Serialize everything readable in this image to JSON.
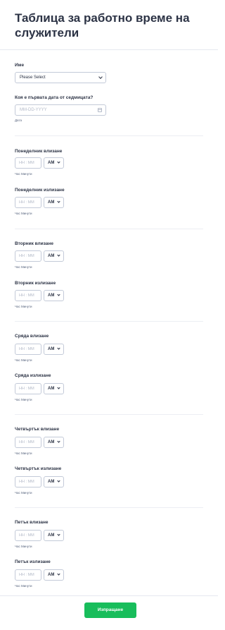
{
  "form": {
    "title": "Таблица за работно време на служители"
  },
  "name_field": {
    "label": "Име",
    "value": "Please Select"
  },
  "first_date_field": {
    "label": "Коя е първата дата от седмицата?",
    "placeholder": "MM-DD-YYYY",
    "sublabel": "Дата"
  },
  "time_fields": [
    {
      "label": "Понеделник влизане",
      "placeholder": "HH : MM",
      "ampm": "AM",
      "sublabel": "Час Минути"
    },
    {
      "label": "Понеделник излизане",
      "placeholder": "HH : MM",
      "ampm": "AM",
      "sublabel": "Час Минути"
    },
    {
      "label": "Вторник влизане",
      "placeholder": "HH : MM",
      "ampm": "AM",
      "sublabel": "Час Минути"
    },
    {
      "label": "Вторник излизане",
      "placeholder": "HH : MM",
      "ampm": "AM",
      "sublabel": "Час Минути"
    },
    {
      "label": "Сряда влизане",
      "placeholder": "HH : MM",
      "ampm": "AM",
      "sublabel": "Час Минути"
    },
    {
      "label": "Сряда излизане",
      "placeholder": "HH : MM",
      "ampm": "AM",
      "sublabel": "Час Минути"
    },
    {
      "label": "Четвъртък влизане",
      "placeholder": "HH : MM",
      "ampm": "AM",
      "sublabel": "Час Минути"
    },
    {
      "label": "Четвъртък излизане",
      "placeholder": "HH : MM",
      "ampm": "AM",
      "sublabel": "Час Минути"
    },
    {
      "label": "Петък влизане",
      "placeholder": "HH : MM",
      "ampm": "AM",
      "sublabel": "Час Минути"
    },
    {
      "label": "Петък излизане",
      "placeholder": "HH : MM",
      "ampm": "AM",
      "sublabel": "Час Минути"
    }
  ],
  "submit": {
    "label": "Изпращане"
  },
  "colors": {
    "submit": "#18bd5b",
    "text": "#2c3345",
    "border": "#c3cad8"
  }
}
